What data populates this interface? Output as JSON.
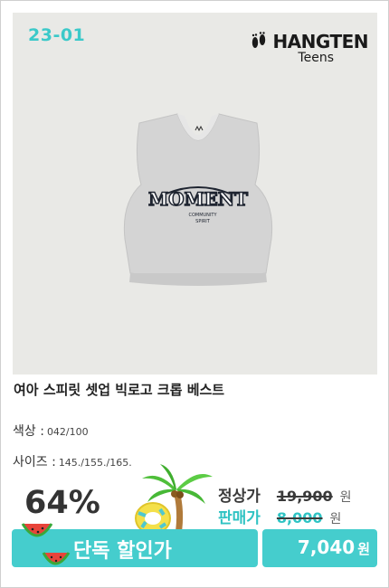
{
  "product": {
    "code": "23-01",
    "brand_name": "HANGTEN",
    "brand_sub": "Teens",
    "print_title": "MOMENT",
    "print_sub1": "COMMUNITY",
    "print_sub2": "SPIRIT",
    "title": "여아 스피릿 셋업 빅로고 크롭 베스트"
  },
  "specs": {
    "color_label": "색상 :",
    "color_value": "042/100",
    "size_label": "사이즈 :",
    "size_value": "145./155./165."
  },
  "pricing": {
    "discount": "64%",
    "regular_label": "정상가",
    "regular_value": "19,900",
    "sale_label": "판매가",
    "sale_value": "8,000",
    "won": "원",
    "banner_label": "단독 할인가",
    "final_value": "7,040",
    "final_won": "원"
  },
  "colors": {
    "accent": "#45cdcd",
    "regular_label": "#3a3a3a",
    "sale_label": "#2fc3c3",
    "strike": "#3a3a3a"
  },
  "icons": [
    "footprints-icon",
    "palm-tree-icon",
    "swim-ring-icon",
    "watermelon-icon"
  ]
}
